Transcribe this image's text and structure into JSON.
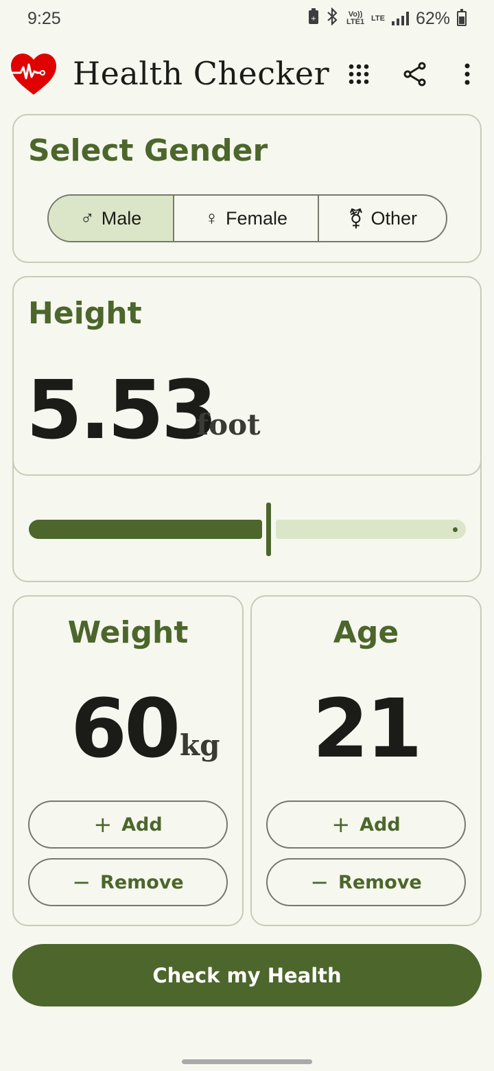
{
  "status": {
    "time": "9:25",
    "volte": "Vo)) LTE1",
    "lte": "LTE",
    "battery": "62%"
  },
  "app": {
    "title": "Health Checker",
    "icons": [
      "heart-pulse-logo-icon",
      "apps-grid-icon",
      "share-icon",
      "more-vert-icon"
    ]
  },
  "gender": {
    "title": "Select Gender",
    "options": [
      {
        "symbol": "♂",
        "label": "Male",
        "selected": true
      },
      {
        "symbol": "♀",
        "label": "Female",
        "selected": false
      },
      {
        "symbol": "⚧",
        "label": "Other",
        "selected": false
      }
    ]
  },
  "height": {
    "title": "Height",
    "value": "5.53",
    "unit": "foot",
    "slider_fraction": 0.55
  },
  "weight": {
    "title": "Weight",
    "value": "60",
    "unit": "kg",
    "add_label": "Add",
    "remove_label": "Remove"
  },
  "age": {
    "title": "Age",
    "value": "21",
    "add_label": "Add",
    "remove_label": "Remove"
  },
  "cta": {
    "label": "Check my Health"
  },
  "colors": {
    "primary": "#4c662b",
    "primary_container": "#dbe6c9",
    "background": "#f6f7ef",
    "outline": "#75796c",
    "heart": "#e00000"
  }
}
